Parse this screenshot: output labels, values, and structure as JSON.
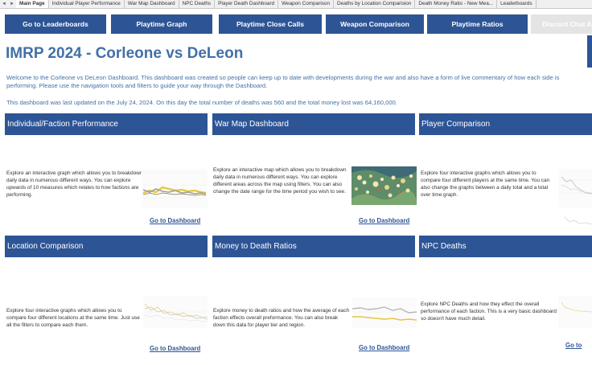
{
  "tabs": {
    "nav_prev": "◄",
    "items": [
      "Main Page",
      "Individual Player Performance",
      "War Map Dashboard",
      "NPC Deaths",
      "Player Death Dashboard",
      "Weapon Comparison",
      "Deaths by Location Comparision",
      "Death Money Ratio - New Mea...",
      "Leaderboards"
    ]
  },
  "nav": {
    "leaderboards": "Go to Leaderboards",
    "playtime_graph": "Playtime Graph",
    "close_calls": "Playtime Close Calls",
    "weapon_comparison": "Weapon Comparison",
    "playtime_ratios": "Playtime Ratios",
    "discord": "Discord Chat An..."
  },
  "page": {
    "title": "IMRP 2024 - Corleone vs DeLeon",
    "intro": "Welcome to the Corleone vs DeLeon Dashboard. This dashboard was created so people can keep up to date with developments during the war and also have a form of live commentary of how each side is performing. Please use the navigation tools and filters to guide your way through the Dashboard.",
    "updated": "This dashboard was last updated on the July 24, 2024. On this day the total number of deaths was 560 and the total money lost was 64,160,000."
  },
  "cards": {
    "individual": {
      "title": "Individual/Faction Performance",
      "desc": "Explore an interactive graph which allows you to breakdown daily data in numerous different ways. You can explore upwards of 10 measures which relates to how factions are performing.",
      "link": "Go to Dashboard"
    },
    "warmap": {
      "title": "War Map Dashboard",
      "desc": "Explore an interactive map which allows you to breakdown daily data in numerous different ways. You can explore different areas across the map using filters. You can also change the date range for the time period you wish to see.",
      "link": "Go to Dashboard"
    },
    "player": {
      "title": "Player Comparison",
      "desc": "Explore four interactive graphs which allows you to compare four different players at the same time. You can also change the graphs between a daily total and a total over time graph.",
      "link": "Go to Dashboard"
    },
    "location": {
      "title": "Location Comparison",
      "desc": "Explore four interactive graphs which allows you to compare four different locations at the same time. Just use all the filters to compare each them.",
      "link": "Go to Dashboard"
    },
    "money": {
      "title": "Money to Death Ratios",
      "desc": "Explore money to death ratios and how the average of each faction effects overall preformance. You can also break down this data for player tier and region.",
      "link": "Go to Dashboard"
    },
    "npc": {
      "title": "NPC Deaths",
      "desc": "Explore NPC Deaths and how they effect the overall performance of each faction. This is a very basic dashboard so doesn't have much detail.",
      "link": "Go to"
    }
  },
  "colors": {
    "accent": "#2d5596",
    "title": "#4270a6",
    "line_gold": "#e8c53a",
    "line_grey": "#a0a0a0"
  }
}
